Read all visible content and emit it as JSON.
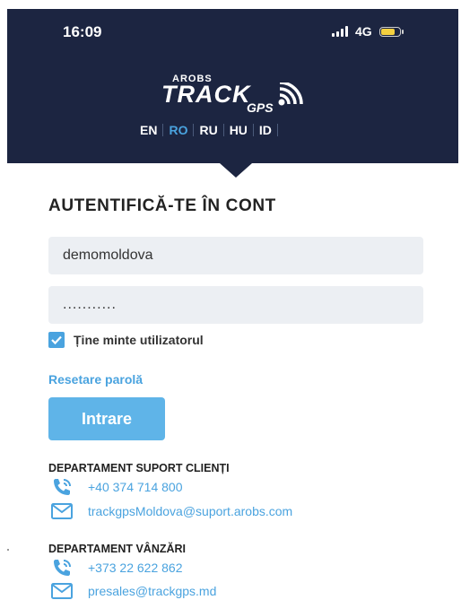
{
  "status_bar": {
    "time": "16:09",
    "network": "4G",
    "battery_level": 0.6
  },
  "logo": {
    "line1": "AROBS",
    "line2": "TRACK",
    "line3": "GPS"
  },
  "languages": {
    "items": [
      "EN",
      "RO",
      "RU",
      "HU",
      "ID"
    ],
    "active": "RO"
  },
  "login": {
    "title": "AUTENTIFICĂ-TE ÎN CONT",
    "username_value": "demomoldova",
    "password_value": "...........",
    "remember_label": "Ține minte utilizatorul",
    "remember_checked": true,
    "reset_link": "Resetare parolă",
    "submit_label": "Intrare"
  },
  "support": {
    "heading": "DEPARTAMENT SUPORT CLIENȚI",
    "phone": "+40 374 714 800",
    "email": "trackgpsMoldova@suport.arobs.com"
  },
  "sales": {
    "heading": "DEPARTAMENT VÂNZĂRI",
    "phone": "+373 22 622 862",
    "email": "presales@trackgps.md"
  },
  "colors": {
    "header_bg": "#1c2541",
    "accent": "#4aa3df",
    "button": "#5fb4e8",
    "field_bg": "#eceff3"
  }
}
